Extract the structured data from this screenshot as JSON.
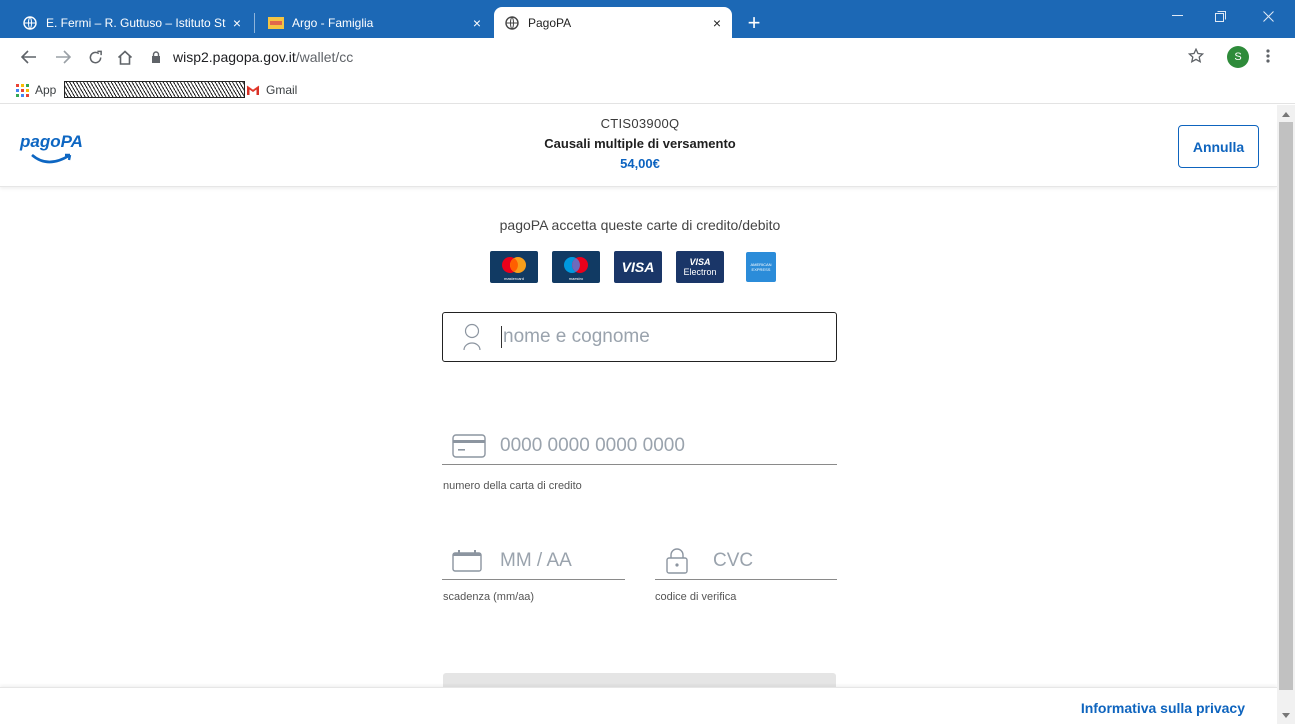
{
  "browser": {
    "tabs": [
      {
        "title": "E. Fermi – R. Guttuso – Istituto St",
        "icon": "globe-icon"
      },
      {
        "title": "Argo - Famiglia",
        "icon": "argo-icon"
      },
      {
        "title": "PagoPA",
        "icon": "globe-icon"
      }
    ],
    "close_glyph": "×",
    "new_tab_glyph": "+",
    "url_host": "wisp2.pagopa.gov.it",
    "url_path": "/wallet/cc",
    "profile_initial": "S",
    "bookmarks": {
      "apps_label": "App",
      "gmail_label": "Gmail"
    }
  },
  "header": {
    "logo_text": "pagoPA",
    "creditor_code": "CTIS03900Q",
    "reason": "Causali multiple di versamento",
    "amount": "54,00€",
    "cancel_label": "Annulla"
  },
  "cards": {
    "intro": "pagoPA accetta queste carte di credito/debito",
    "mastercard_label": "mastercard",
    "maestro_label": "maestro",
    "visa_label": "VISA",
    "visa_electron_top": "VISA",
    "visa_electron_bottom": "Electron",
    "amex_label": "AMERICAN EXPRESS"
  },
  "form": {
    "name_placeholder": "nome e cognome",
    "card_placeholder": "0000 0000 0000 0000",
    "card_help": "numero della carta di credito",
    "expiry_placeholder": "MM / AA",
    "expiry_help": "scadenza (mm/aa)",
    "cvc_placeholder": "CVC",
    "cvc_help": "codice di verifica"
  },
  "footer": {
    "privacy_label": "Informativa sulla privacy"
  },
  "colors": {
    "chrome_blue": "#1c68b5",
    "pagopa_blue": "#0e64be"
  }
}
